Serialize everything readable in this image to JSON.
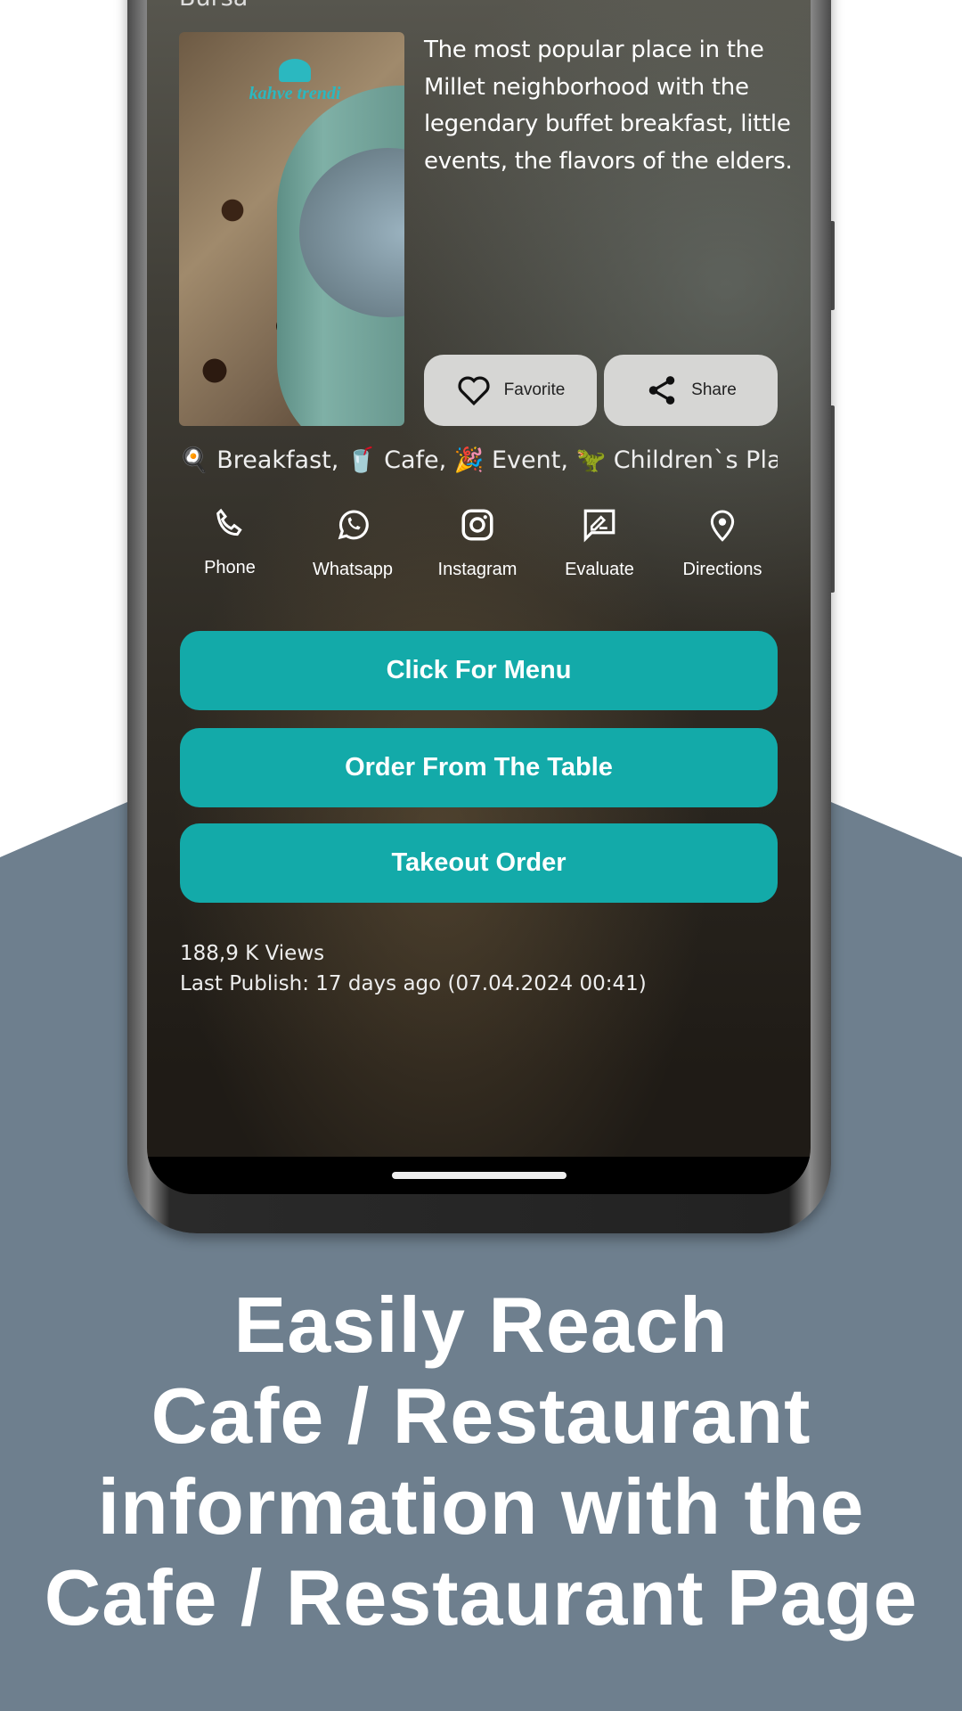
{
  "colors": {
    "accent": "#13aaa9",
    "background_panel": "#6e7f8e"
  },
  "place": {
    "city": "Bursa",
    "logo_text": "kahve trendi",
    "description": "The most popular place in the Millet neighborhood with the legendary buffet breakfast, little events, the flavors of the elders.",
    "favorite_label": "Favorite",
    "share_label": "Share",
    "categories": "🍳 Breakfast, 🥤 Cafe, 🎉 Event, 🦖 Children`s Playground"
  },
  "actions": [
    {
      "label": "Phone",
      "icon": "phone-icon"
    },
    {
      "label": "Whatsapp",
      "icon": "whatsapp-icon"
    },
    {
      "label": "Instagram",
      "icon": "instagram-icon"
    },
    {
      "label": "Evaluate",
      "icon": "evaluate-icon"
    },
    {
      "label": "Directions",
      "icon": "location-pin-icon"
    }
  ],
  "buttons": {
    "menu": "Click For Menu",
    "table_order": "Order From The Table",
    "takeout": "Takeout Order"
  },
  "meta": {
    "views": "188,9 K Views",
    "last_publish": "Last Publish: 17 days ago (07.04.2024 00:41)"
  },
  "headline": [
    "Easily Reach",
    "Cafe / Restaurant",
    "information with the",
    "Cafe / Restaurant Page"
  ]
}
